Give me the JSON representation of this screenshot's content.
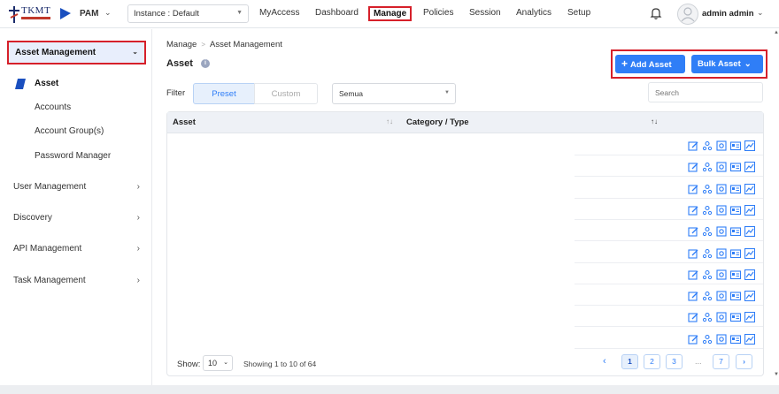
{
  "topbar": {
    "logo_text": "TKMT",
    "product": "PAM",
    "instance": "Instance : Default",
    "nav": [
      "MyAccess",
      "Dashboard",
      "Manage",
      "Policies",
      "Session",
      "Analytics",
      "Setup"
    ],
    "active_nav": "Manage",
    "username": "admin admin"
  },
  "sidebar": {
    "section": "Asset Management",
    "sub_items": [
      "Asset",
      "Accounts",
      "Account Group(s)",
      "Password Manager"
    ],
    "active_sub": "Asset",
    "groups": [
      "User Management",
      "Discovery",
      "API Management",
      "Task Management"
    ]
  },
  "main": {
    "breadcrumb": [
      "Manage",
      "Asset Management"
    ],
    "title": "Asset",
    "add_button": "Add Asset",
    "bulk_button": "Bulk Asset",
    "filter_label": "Filter",
    "filter_tabs": [
      "Preset",
      "Custom"
    ],
    "active_filter": "Preset",
    "select_value": "Semua",
    "search_placeholder": "Search",
    "table": {
      "columns": [
        "Asset",
        "Category / Type"
      ],
      "row_count": 10,
      "row_actions": [
        "edit-icon",
        "users-icon",
        "settings-icon",
        "id-card-icon",
        "chart-icon"
      ]
    },
    "pagination": {
      "show_label": "Show:",
      "page_size": "10",
      "showing": "Showing 1 to 10 of 64",
      "pages": [
        "1",
        "2",
        "3",
        "...",
        "7"
      ],
      "current_page": "1"
    }
  },
  "colors": {
    "accent": "#2f7ef7",
    "highlight": "#d6202a",
    "sidebar_active_bg": "#e8eefc"
  }
}
